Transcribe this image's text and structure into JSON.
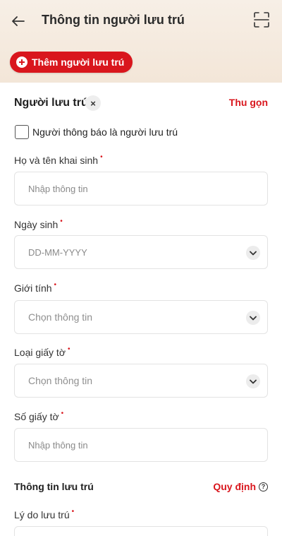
{
  "header": {
    "title": "Thông tin người lưu trú"
  },
  "actions": {
    "add_resident": "Thêm người lưu trú"
  },
  "resident_section": {
    "title": "Người lưu trú",
    "remove": "×",
    "collapse": "Thu gọn",
    "checkbox_label": "Người thông báo là người lưu trú"
  },
  "fields": {
    "full_name": {
      "label": "Họ và tên khai sinh",
      "placeholder": "Nhập thông tin"
    },
    "dob": {
      "label": "Ngày sinh",
      "placeholder": "DD-MM-YYYY"
    },
    "gender": {
      "label": "Giới tính",
      "placeholder": "Chọn thông tin"
    },
    "doc_type": {
      "label": "Loại giấy tờ",
      "placeholder": "Chọn thông tin"
    },
    "doc_number": {
      "label": "Số giấy tờ",
      "placeholder": "Nhập thông tin"
    }
  },
  "stay_section": {
    "title": "Thông tin lưu trú",
    "rules": "Quy định",
    "reason_label": "Lý do lưu trú"
  },
  "required_mark": "•",
  "colors": {
    "accent": "#d9161d",
    "header_bg": "#f5ebe0"
  }
}
